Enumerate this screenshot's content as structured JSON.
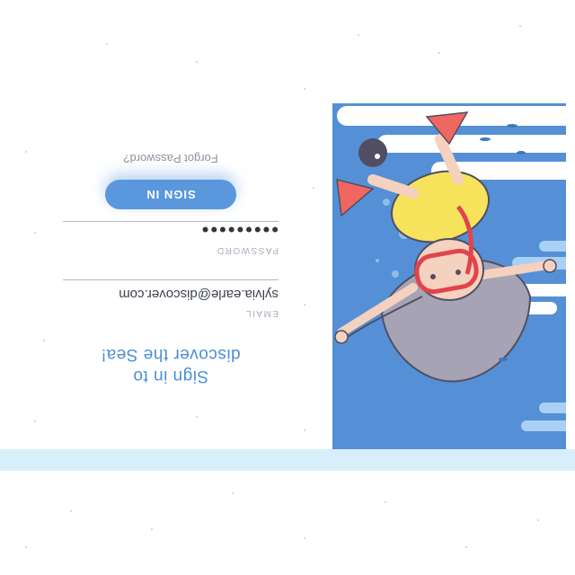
{
  "page": {
    "title_line1": "Sign in to",
    "title_line2": "discover the Sea!"
  },
  "form": {
    "email_label": "EMAIL",
    "email_value": "sylvia.earle@discover.com",
    "password_label": "PASSWORD",
    "password_value": "•••••••••",
    "signin_label": "SIGN IN",
    "forgot_label": "Forgot Password?"
  },
  "illustration": {
    "subject": "girl snorkeling with pufferfish"
  },
  "colors": {
    "accent": "#5b97dc",
    "title": "#4a8fd6",
    "ocean": "#5590d6",
    "strip": "#d7effa"
  }
}
